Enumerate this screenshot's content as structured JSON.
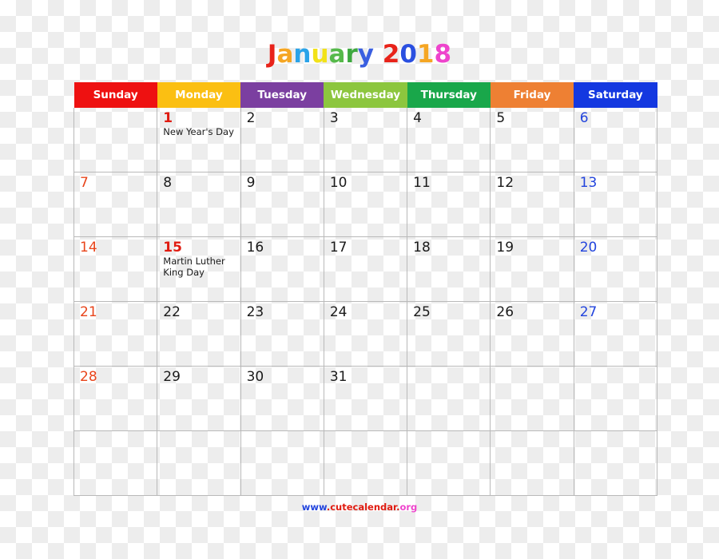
{
  "title": {
    "text": "January 2018",
    "letters": [
      {
        "ch": "J",
        "color": "#e8231a"
      },
      {
        "ch": "a",
        "color": "#f5a623"
      },
      {
        "ch": "n",
        "color": "#2aa3e8"
      },
      {
        "ch": "u",
        "color": "#f2e219"
      },
      {
        "ch": "a",
        "color": "#56b94a"
      },
      {
        "ch": "r",
        "color": "#3da83f"
      },
      {
        "ch": "y",
        "color": "#3a5fe0"
      },
      {
        "ch": " ",
        "color": "#000000"
      },
      {
        "ch": "2",
        "color": "#e8231a"
      },
      {
        "ch": "0",
        "color": "#2a4fe0"
      },
      {
        "ch": "1",
        "color": "#f5a623"
      },
      {
        "ch": "8",
        "color": "#ee44cc"
      }
    ]
  },
  "weekdays": [
    {
      "label": "Sunday",
      "color": "#ee1111"
    },
    {
      "label": "Monday",
      "color": "#fbbf12"
    },
    {
      "label": "Tuesday",
      "color": "#7b3fa0"
    },
    {
      "label": "Wednesday",
      "color": "#8cc63e"
    },
    {
      "label": "Thursday",
      "color": "#19a74a"
    },
    {
      "label": "Friday",
      "color": "#ee8033"
    },
    {
      "label": "Saturday",
      "color": "#1438e0"
    }
  ],
  "colors": {
    "sunday_number": "#e8441a",
    "saturday_number": "#2244dd",
    "weekday_number": "#1a1a1a",
    "holiday_number": "#e01b10",
    "grid_line": "#b9b9b9"
  },
  "weeks": [
    [
      {
        "day": "",
        "event": ""
      },
      {
        "day": "1",
        "event": "New Year's Day",
        "holiday": true
      },
      {
        "day": "2",
        "event": ""
      },
      {
        "day": "3",
        "event": ""
      },
      {
        "day": "4",
        "event": ""
      },
      {
        "day": "5",
        "event": ""
      },
      {
        "day": "6",
        "event": ""
      }
    ],
    [
      {
        "day": "7",
        "event": ""
      },
      {
        "day": "8",
        "event": ""
      },
      {
        "day": "9",
        "event": ""
      },
      {
        "day": "10",
        "event": ""
      },
      {
        "day": "11",
        "event": ""
      },
      {
        "day": "12",
        "event": ""
      },
      {
        "day": "13",
        "event": ""
      }
    ],
    [
      {
        "day": "14",
        "event": ""
      },
      {
        "day": "15",
        "event": "Martin Luther King Day",
        "holiday": true
      },
      {
        "day": "16",
        "event": ""
      },
      {
        "day": "17",
        "event": ""
      },
      {
        "day": "18",
        "event": ""
      },
      {
        "day": "19",
        "event": ""
      },
      {
        "day": "20",
        "event": ""
      }
    ],
    [
      {
        "day": "21",
        "event": ""
      },
      {
        "day": "22",
        "event": ""
      },
      {
        "day": "23",
        "event": ""
      },
      {
        "day": "24",
        "event": ""
      },
      {
        "day": "25",
        "event": ""
      },
      {
        "day": "26",
        "event": ""
      },
      {
        "day": "27",
        "event": ""
      }
    ],
    [
      {
        "day": "28",
        "event": ""
      },
      {
        "day": "29",
        "event": ""
      },
      {
        "day": "30",
        "event": ""
      },
      {
        "day": "31",
        "event": ""
      },
      {
        "day": "",
        "event": ""
      },
      {
        "day": "",
        "event": ""
      },
      {
        "day": "",
        "event": ""
      }
    ],
    [
      {
        "day": "",
        "event": ""
      },
      {
        "day": "",
        "event": ""
      },
      {
        "day": "",
        "event": ""
      },
      {
        "day": "",
        "event": ""
      },
      {
        "day": "",
        "event": ""
      },
      {
        "day": "",
        "event": ""
      },
      {
        "day": "",
        "event": ""
      }
    ]
  ],
  "footer": {
    "text": "www.cutecalendar.org",
    "segments": [
      {
        "text": "www",
        "color": "#2244dd"
      },
      {
        "text": ".",
        "color": "#e01b10"
      },
      {
        "text": "cutecalendar",
        "color": "#e01b10"
      },
      {
        "text": ".",
        "color": "#e01b10"
      },
      {
        "text": "org",
        "color": "#ee44cc"
      }
    ]
  }
}
